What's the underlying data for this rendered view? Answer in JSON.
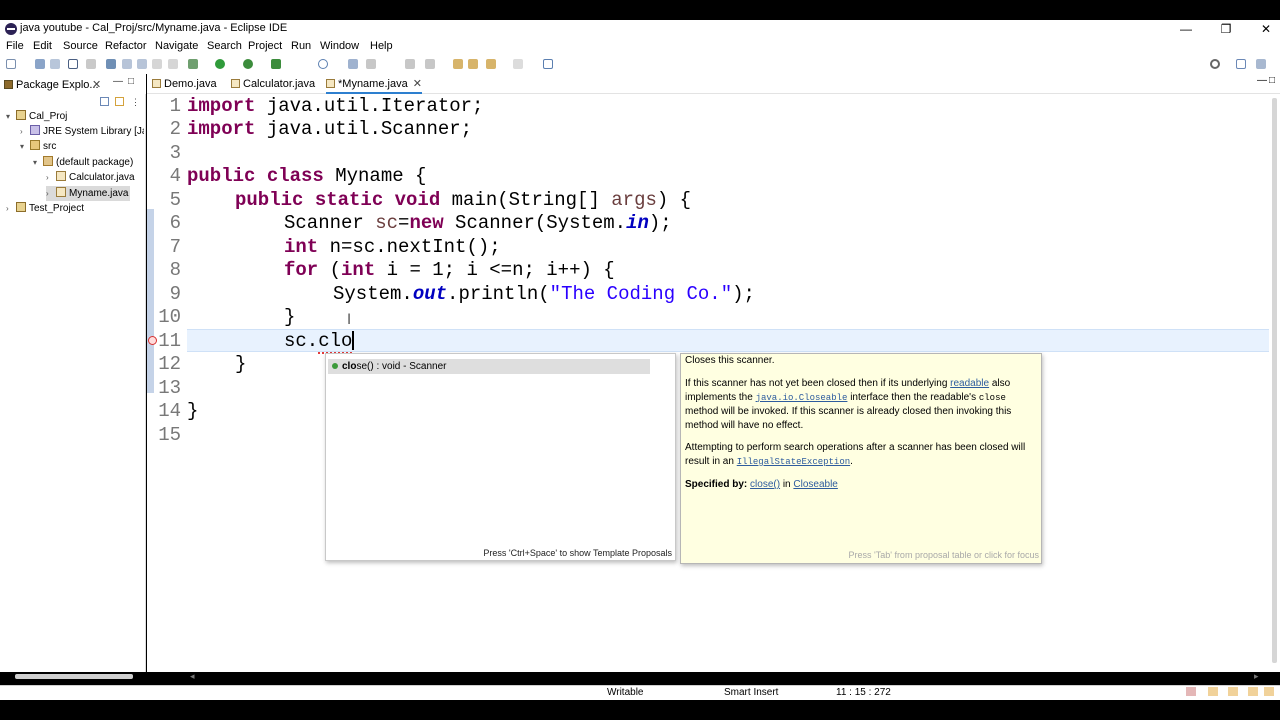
{
  "window": {
    "title": "java youtube - Cal_Proj/src/Myname.java - Eclipse IDE",
    "minimize": "—",
    "restore": "❐",
    "close": "✕"
  },
  "menu": [
    "File",
    "Edit",
    "Source",
    "Refactor",
    "Navigate",
    "Search",
    "Project",
    "Run",
    "Window",
    "Help"
  ],
  "package_explorer": {
    "tab_label": "Package Explo...",
    "close": "✕",
    "tree": [
      {
        "label": "Cal_Proj",
        "arrow": "▾",
        "icon": "project-icon"
      },
      {
        "label": "JRE System Library [Ja",
        "arrow": "›",
        "icon": "library-icon"
      },
      {
        "label": "src",
        "arrow": "▾",
        "icon": "source-folder-icon"
      },
      {
        "label": "(default package)",
        "arrow": "▾",
        "icon": "package-icon"
      },
      {
        "label": "Calculator.java",
        "arrow": "›",
        "icon": "java-file-icon"
      },
      {
        "label": "Myname.java",
        "arrow": "›",
        "icon": "java-file-icon",
        "selected": true
      },
      {
        "label": "Test_Project",
        "arrow": "›",
        "icon": "project-icon"
      }
    ]
  },
  "editor": {
    "tabs": [
      {
        "label": "Demo.java"
      },
      {
        "label": "Calculator.java"
      },
      {
        "label": "*Myname.java",
        "close": "✕",
        "active": true
      }
    ],
    "line_numbers": [
      "1",
      "2",
      "3",
      "4",
      "5",
      "6",
      "7",
      "8",
      "9",
      "10",
      "11",
      "12",
      "13",
      "14",
      "15"
    ],
    "code": {
      "l1_kw": "import",
      "l1_rest": " java.util.Iterator;",
      "l2_kw": "import",
      "l2_rest": " java.util.Scanner;",
      "l4_kw": "public class",
      "l4_rest": " Myname {",
      "l5_kw": "public static void",
      "l5_rest": " main(String[] ",
      "l5_arg": "args",
      "l5_end": ") {",
      "l6_a": "Scanner ",
      "l6_var": "sc",
      "l6_eq": "=",
      "l6_kw": "new",
      "l6_b": " Scanner(System.",
      "l6_field": "in",
      "l6_end": ");",
      "l7_kw": "int",
      "l7_rest": " n=sc.nextInt();",
      "l8_kw": "for",
      "l8_a": " (",
      "l8_kw2": "int",
      "l8_rest": " i = 1; i <=n; i++) {",
      "l9_a": "System.",
      "l9_field": "out",
      "l9_b": ".println(",
      "l9_str": "\"The Coding Co.\"",
      "l9_end": ");",
      "l10": "}",
      "l11_a": "sc.",
      "l11_err": "clo",
      "l12": "}",
      "l14": "}"
    }
  },
  "proposals": {
    "item_bold": "clo",
    "item_rest": "se() : void - Scanner",
    "footer": "Press 'Ctrl+Space' to show Template Proposals"
  },
  "javadoc": {
    "summary": "Closes this scanner.",
    "p1_a": "If this scanner has not yet been closed then if its underlying ",
    "p1_link": "readable",
    "p1_b": " also implements the ",
    "p1_code_link": "java.io.Closeable",
    "p1_c": " interface then the readable's ",
    "p1_code": "close",
    "p1_d": " method will be invoked. If this scanner is already closed then invoking this method will have no effect.",
    "p2_a": "Attempting to perform search operations after a scanner has been closed will result in an ",
    "p2_link": "IllegalStateException",
    "p2_b": ".",
    "specified_label": "Specified by:",
    "specified_link1": "close()",
    "specified_in": " in ",
    "specified_link2": "Closeable",
    "footer": "Press 'Tab' from proposal table or click for focus"
  },
  "status": {
    "mode": "Writable",
    "insert": "Smart Insert",
    "position": "11 : 15 : 272"
  }
}
